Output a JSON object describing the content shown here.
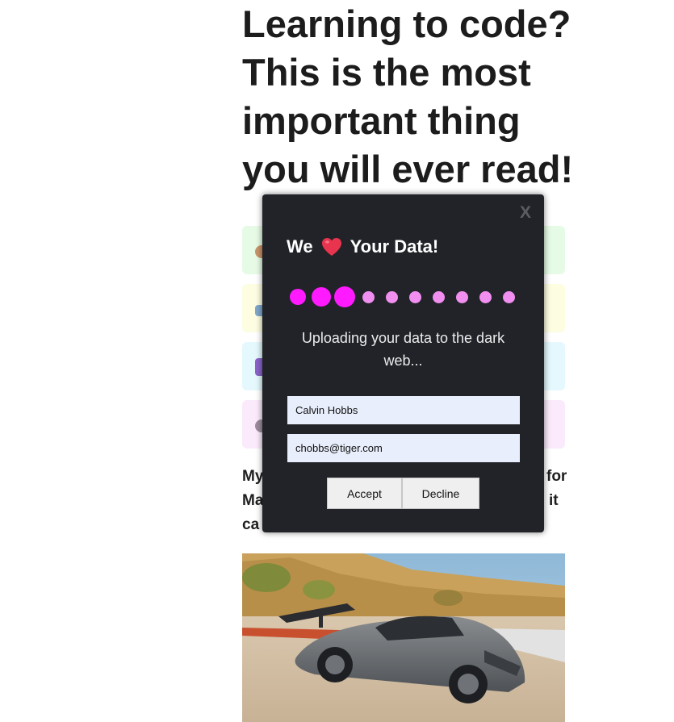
{
  "article": {
    "headline": "Learning to code? This is the most important thing you will ever read!",
    "paragraph_fragments": {
      "line1_start": "My",
      "line1_end": "for",
      "line2_start": "Ma",
      "line2_end": "it",
      "line3_start": "ca"
    }
  },
  "modal": {
    "close_label": "X",
    "title_before": "We",
    "title_after": "Your Data!",
    "heart_color": "#e8344e",
    "progress": {
      "total_steps": 10,
      "completed_steps": 3,
      "active_color": "#ff1aff",
      "inactive_color": "#f08ff0"
    },
    "status_text": "Uploading your data to the dark web...",
    "name_value": "Calvin Hobbs",
    "email_value": "chobbs@tiger.com",
    "accept_label": "Accept",
    "decline_label": "Decline"
  }
}
